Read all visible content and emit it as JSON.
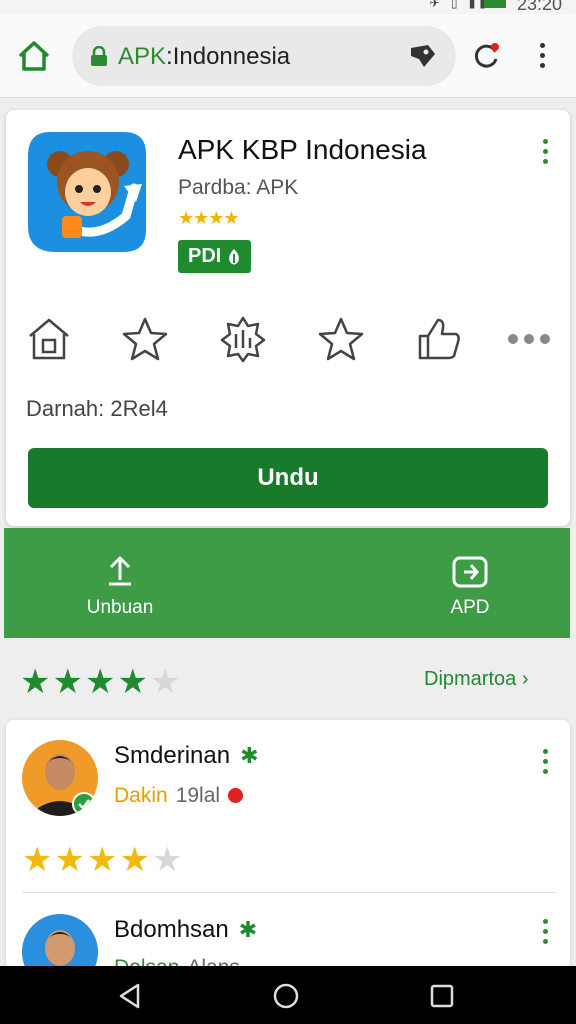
{
  "status": {
    "time": "23:20"
  },
  "browser": {
    "url_prefix": "APK",
    "url_rest": "Indonnesia"
  },
  "app": {
    "title": "APK KBP Indonesia",
    "subtitle": "Pardba: APK",
    "stars": "★★★★",
    "badge": "PDI",
    "size_text": "Darnah: 2Rel4",
    "download_label": "Undu"
  },
  "banner": {
    "left_label": "Unbuan",
    "right_label": "APD"
  },
  "rating": {
    "score": 4,
    "max": 5,
    "see_all_label": "Dipmartoa"
  },
  "reviews": [
    {
      "name": "Smderinan",
      "meta_1": "Dakin",
      "meta_2": "19lal",
      "rating": 4,
      "max": 5
    },
    {
      "name": "Bdomhsan",
      "meta_1": "Dolsan",
      "meta_2": "Alans"
    }
  ],
  "colors": {
    "primary_green": "#1f8a2e",
    "banner_green": "#3e9b46",
    "star_gold": "#f2b90c"
  }
}
